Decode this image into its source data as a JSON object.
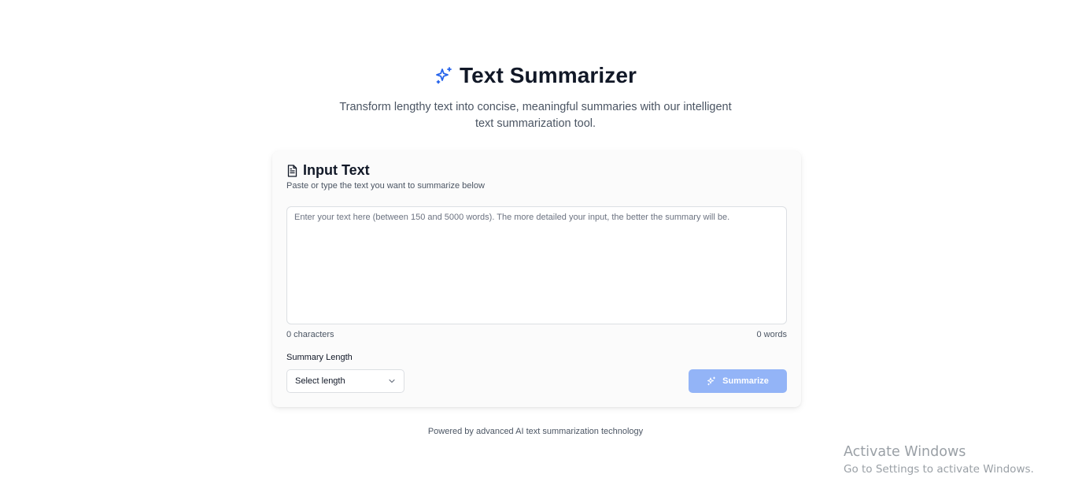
{
  "header": {
    "title": "Text Summarizer",
    "title_icon": "sparkles-icon",
    "subtitle": "Transform lengthy text into concise, meaningful summaries with our intelligent text summarization tool."
  },
  "card": {
    "title": "Input Text",
    "title_icon": "document-icon",
    "description": "Paste or type the text you want to summarize below",
    "textarea": {
      "value": "",
      "placeholder": "Enter your text here (between 150 and 5000 words). The more detailed your input, the better the summary will be."
    },
    "char_count": "0 characters",
    "word_count": "0 words",
    "length_label": "Summary Length",
    "length_select": {
      "selected": "Select length",
      "icon": "chevron-down-icon"
    },
    "summarize_button": {
      "label": "Summarize",
      "icon": "sparkles-icon",
      "disabled": true
    }
  },
  "footer": {
    "text": "Powered by advanced AI text summarization technology"
  },
  "watermark": {
    "title": "Activate Windows",
    "subtitle": "Go to Settings to activate Windows."
  },
  "colors": {
    "accent": "#2563eb",
    "button_disabled": "#93b4f7",
    "card_background": "#fbfbfb",
    "text_primary": "#111827",
    "text_muted": "#4b5563"
  }
}
